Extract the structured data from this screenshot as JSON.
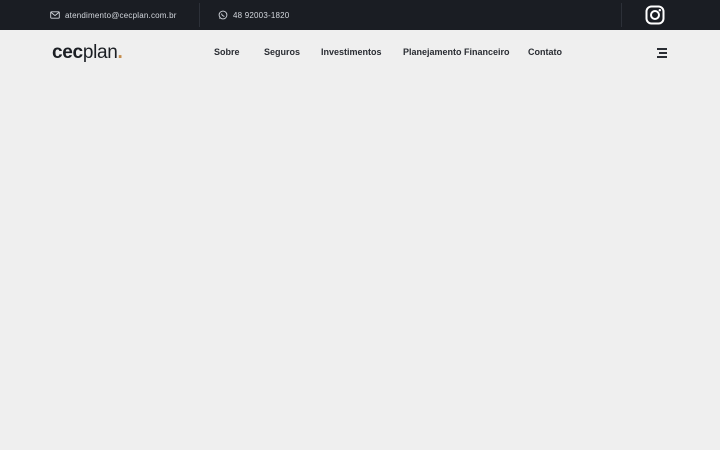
{
  "topbar": {
    "email": {
      "icon": "mail-icon",
      "text": "atendimento@cecplan.com.br"
    },
    "phone": {
      "icon": "whatsapp-icon",
      "text": "48 92003-1820"
    },
    "social": {
      "icon": "instagram-icon"
    }
  },
  "header": {
    "logo": {
      "bold": "cec",
      "light": "plan",
      "dot": "."
    },
    "nav": [
      {
        "label": "Sobre"
      },
      {
        "label": "Seguros"
      },
      {
        "label": "Investimentos"
      },
      {
        "label": "Planejamento Financeiro"
      },
      {
        "label": "Contato"
      }
    ],
    "menu_icon": "hamburger-menu-icon"
  },
  "colors": {
    "topbar_bg": "#1a1d23",
    "page_bg": "#efefef",
    "logo_accent": "#c58d4d"
  }
}
